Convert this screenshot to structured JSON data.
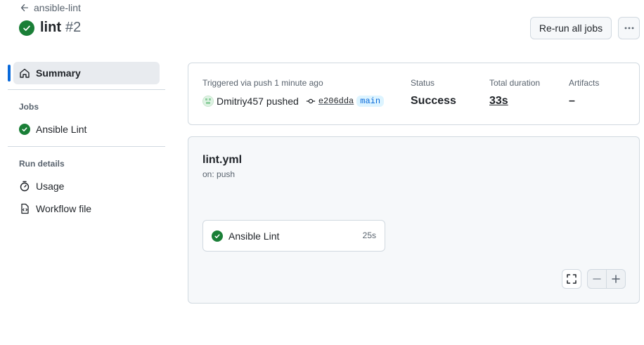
{
  "header": {
    "back_label": "ansible-lint",
    "workflow_name": "lint",
    "run_number": "#2",
    "rerun_label": "Re-run all jobs"
  },
  "sidebar": {
    "summary_label": "Summary",
    "jobs_heading": "Jobs",
    "jobs": [
      {
        "label": "Ansible Lint",
        "status": "success"
      }
    ],
    "run_details_heading": "Run details",
    "run_details": [
      {
        "label": "Usage",
        "icon": "stopwatch-icon"
      },
      {
        "label": "Workflow file",
        "icon": "file-code-icon"
      }
    ]
  },
  "summary": {
    "triggered_text": "Triggered via push 1 minute ago",
    "user": "Dmitriy457",
    "action": "pushed",
    "commit_sha": "e206dda",
    "branch": "main",
    "status_label": "Status",
    "status_value": "Success",
    "duration_label": "Total duration",
    "duration_value": "33s",
    "artifacts_label": "Artifacts",
    "artifacts_value": "–"
  },
  "graph": {
    "workflow_file": "lint.yml",
    "trigger": "on: push",
    "jobs": [
      {
        "name": "Ansible Lint",
        "duration": "25s",
        "status": "success"
      }
    ]
  },
  "colors": {
    "success": "#1a7f37",
    "accent": "#0969da"
  }
}
